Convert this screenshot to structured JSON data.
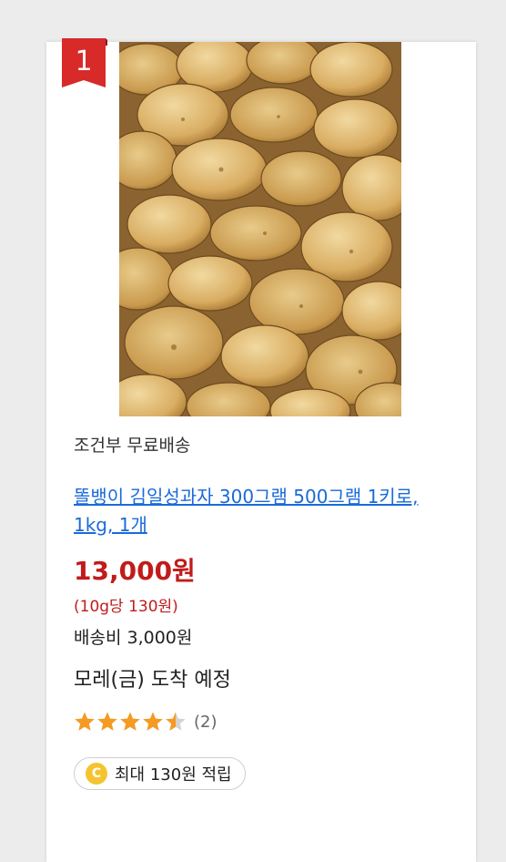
{
  "rank": "1",
  "product_image_alt": "",
  "shipping_condition": "조건부 무료배송",
  "title": "똘뱅이 김일성과자 300그램 500그램 1키로, 1kg, 1개",
  "price": "13,000원",
  "unit_price": "(10g당 130원)",
  "shipping_fee": "배송비 3,000원",
  "arrival": "모레(금) 도착 예정",
  "rating": {
    "value": 4.5,
    "max": 5,
    "review_count": "(2)"
  },
  "points": {
    "coin_label": "C",
    "text": "최대 130원 적립"
  },
  "colors": {
    "badge_red": "#d92a2a",
    "price_red": "#c01c1c",
    "title_link": "#1a6ad9",
    "star_filled": "#f59a23",
    "star_empty": "#d4d4d4",
    "coin": "#f4c430"
  }
}
